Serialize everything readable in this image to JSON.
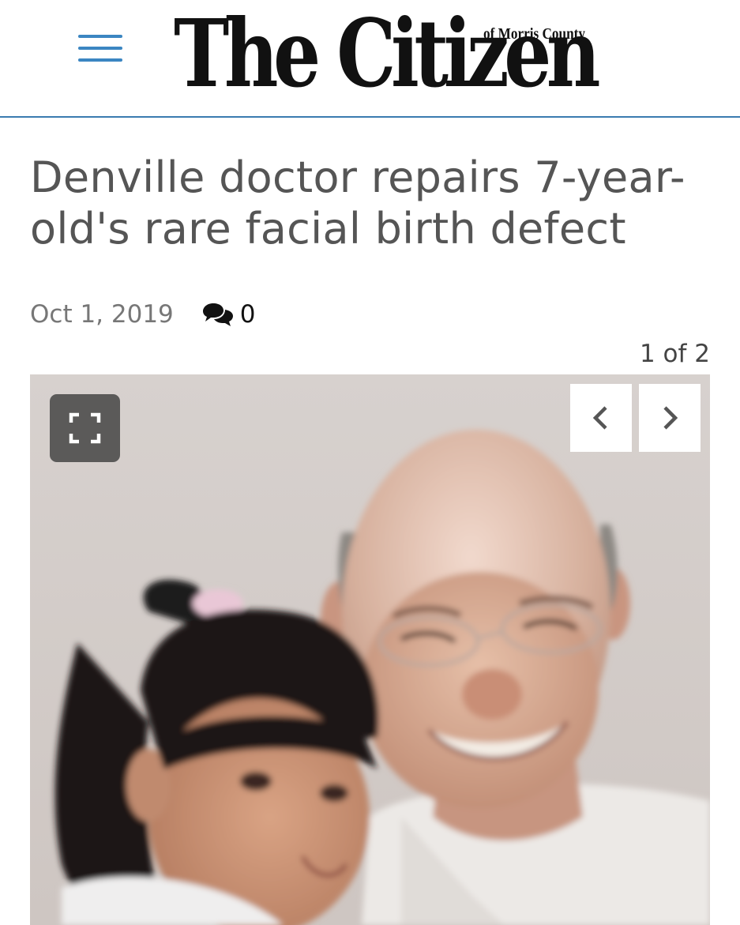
{
  "header": {
    "menu_icon": "hamburger-menu-icon",
    "logo_main": "The Citizen",
    "logo_sub": "of Morris County",
    "accent_color": "#3b86c2"
  },
  "article": {
    "headline": "Denville doctor repairs 7-year-old's rare facial birth defect",
    "date": "Oct 1, 2019",
    "comment_icon": "comments-icon",
    "comment_count": "0"
  },
  "gallery": {
    "counter": "1 of 2",
    "fullscreen_icon": "fullscreen-icon",
    "prev_icon": "chevron-left-icon",
    "next_icon": "chevron-right-icon"
  }
}
